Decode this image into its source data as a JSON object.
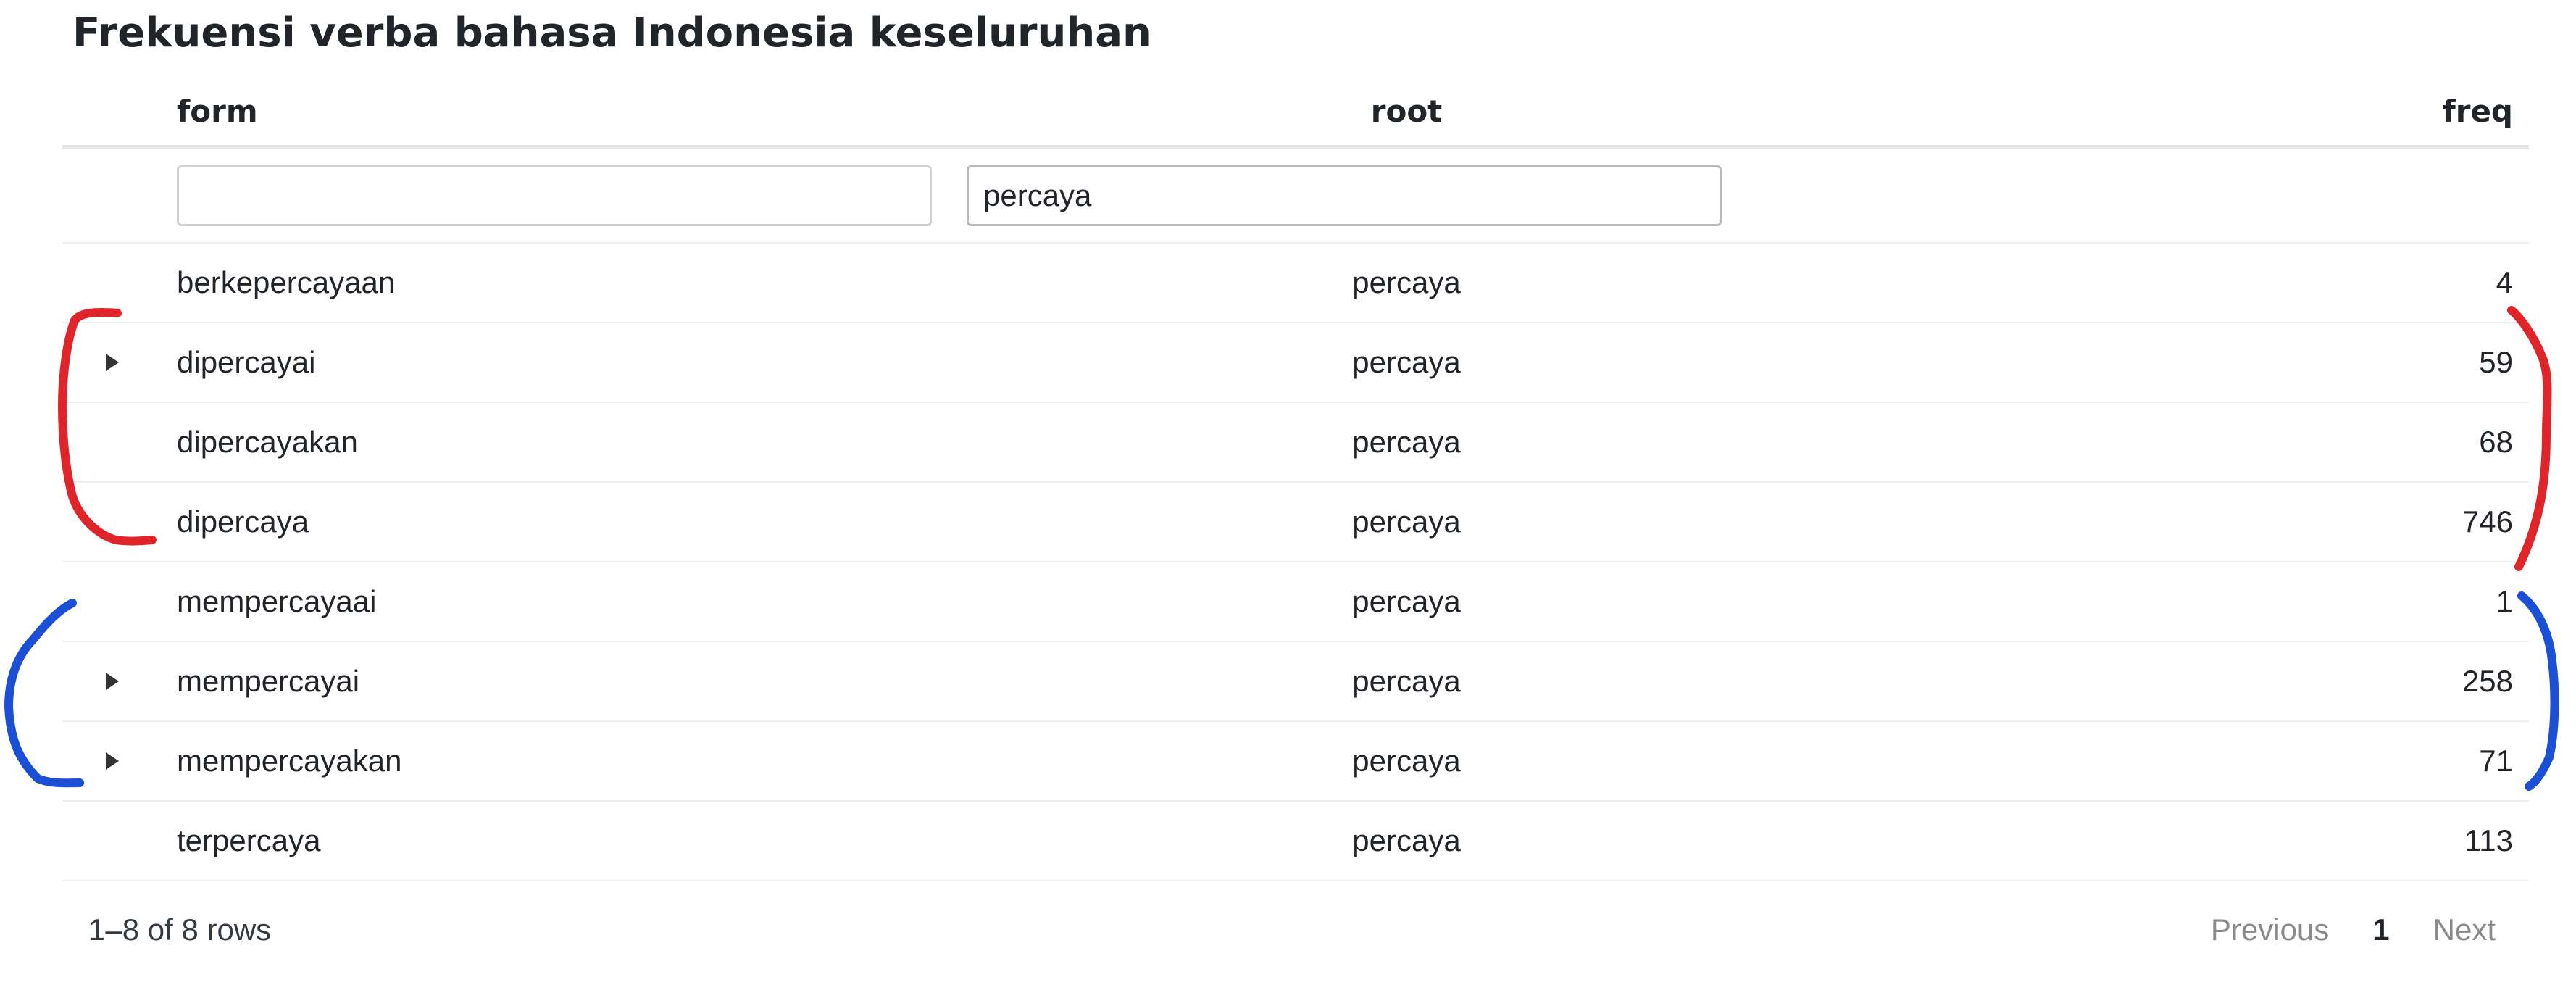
{
  "title": "Frekuensi verba bahasa Indonesia keseluruhan",
  "table": {
    "columns": {
      "form": "form",
      "root": "root",
      "freq": "freq"
    },
    "filters": {
      "form": "",
      "root": "percaya"
    },
    "rows": [
      {
        "form": "berkepercayaan",
        "root": "percaya",
        "freq": "4",
        "expandable": false
      },
      {
        "form": "dipercayai",
        "root": "percaya",
        "freq": "59",
        "expandable": true
      },
      {
        "form": "dipercayakan",
        "root": "percaya",
        "freq": "68",
        "expandable": false
      },
      {
        "form": "dipercaya",
        "root": "percaya",
        "freq": "746",
        "expandable": false
      },
      {
        "form": "mempercayaai",
        "root": "percaya",
        "freq": "1",
        "expandable": false
      },
      {
        "form": "mempercayai",
        "root": "percaya",
        "freq": "258",
        "expandable": true
      },
      {
        "form": "mempercayakan",
        "root": "percaya",
        "freq": "71",
        "expandable": true
      },
      {
        "form": "terpercaya",
        "root": "percaya",
        "freq": "113",
        "expandable": false
      }
    ]
  },
  "pagination": {
    "info": "1–8 of 8 rows",
    "previous": "Previous",
    "current_page": "1",
    "next": "Next"
  },
  "annotation_colors": {
    "red": "#e0252a",
    "blue": "#1a4fd6"
  },
  "icons": {
    "expander": "triangle-right-icon"
  }
}
